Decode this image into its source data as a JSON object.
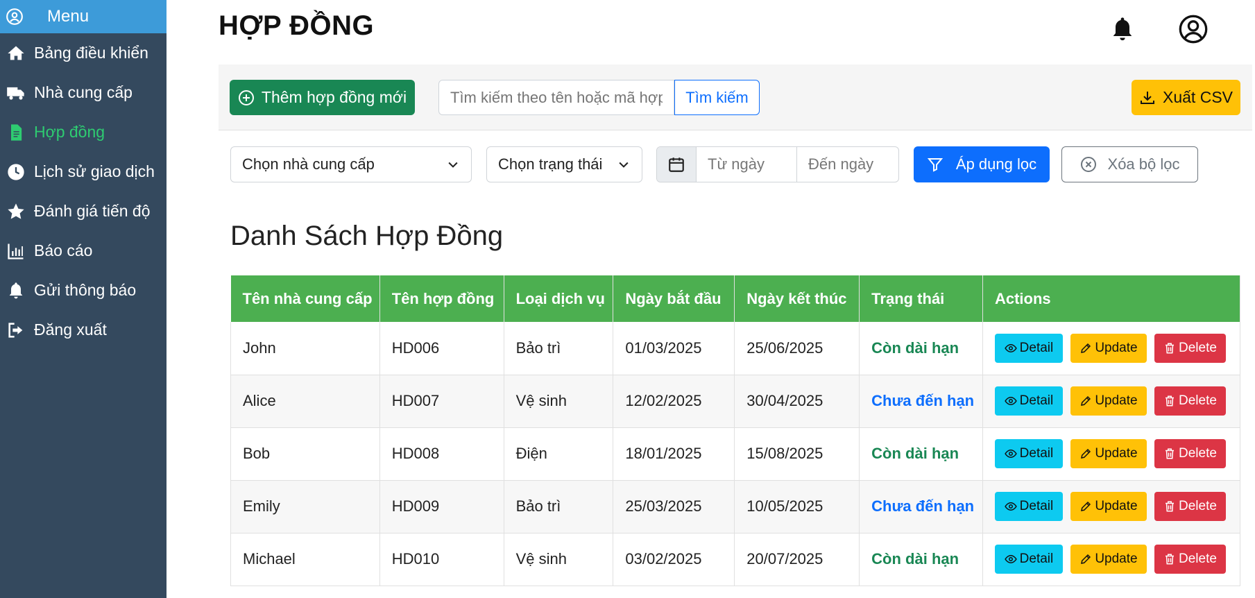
{
  "sidebar": {
    "menu_label": "Menu",
    "items": [
      {
        "label": "Bảng điều khiển",
        "icon": "home-icon"
      },
      {
        "label": "Nhà cung cấp",
        "icon": "truck-icon"
      },
      {
        "label": "Hợp đồng",
        "icon": "file-contract-icon"
      },
      {
        "label": "Lịch sử giao dịch",
        "icon": "clock-icon"
      },
      {
        "label": "Đánh giá tiến độ",
        "icon": "star-icon"
      },
      {
        "label": "Báo cáo",
        "icon": "chart-bar-icon"
      },
      {
        "label": "Gửi thông báo",
        "icon": "bell-icon"
      },
      {
        "label": "Đăng xuất",
        "icon": "sign-out-icon"
      }
    ],
    "active_index": 2
  },
  "header": {
    "title": "HỢP ĐỒNG"
  },
  "toolbar": {
    "new_label": "Thêm hợp đồng mới",
    "search_placeholder": "Tìm kiếm theo tên hoặc mã hợp đồng",
    "search_label": "Tìm kiếm",
    "csv_label": "Xuất CSV"
  },
  "filters": {
    "supplier": "Chọn nhà cung cấp",
    "status": "Chọn trạng thái",
    "from": "Từ ngày",
    "to": "Đến ngày",
    "apply": "Áp dụng lọc",
    "clear": "Xóa bộ lọc"
  },
  "list": {
    "title": "Danh Sách Hợp Đồng",
    "columns": [
      "Tên nhà cung cấp",
      "Tên hợp đồng",
      "Loại dịch vụ",
      "Ngày bắt đầu",
      "Ngày kết thúc",
      "Trạng thái",
      "Actions"
    ],
    "rows": [
      {
        "supplier": "John",
        "code": "HD006",
        "service": "Bảo trì",
        "start": "01/03/2025",
        "end": "25/06/2025",
        "status": "Còn dài hạn"
      },
      {
        "supplier": "Alice",
        "code": "HD007",
        "service": "Vệ sinh",
        "start": "12/02/2025",
        "end": "30/04/2025",
        "status": "Chưa đến hạn"
      },
      {
        "supplier": "Bob",
        "code": "HD008",
        "service": "Điện",
        "start": "18/01/2025",
        "end": "15/08/2025",
        "status": "Còn dài hạn"
      },
      {
        "supplier": "Emily",
        "code": "HD009",
        "service": "Bảo trì",
        "start": "25/03/2025",
        "end": "10/05/2025",
        "status": "Chưa đến hạn"
      },
      {
        "supplier": "Michael",
        "code": "HD010",
        "service": "Vệ sinh",
        "start": "03/02/2025",
        "end": "20/07/2025",
        "status": "Còn dài hạn"
      }
    ],
    "actions": {
      "detail": "Detail",
      "update": "Update",
      "delete": "Delete"
    }
  },
  "colors": {
    "sidebar": "#34495e",
    "menu_header": "#3d9bd9",
    "active": "#2ecc71",
    "table_header": "#4caf50",
    "status_long": "#198754",
    "status_due": "#0d6efd"
  }
}
